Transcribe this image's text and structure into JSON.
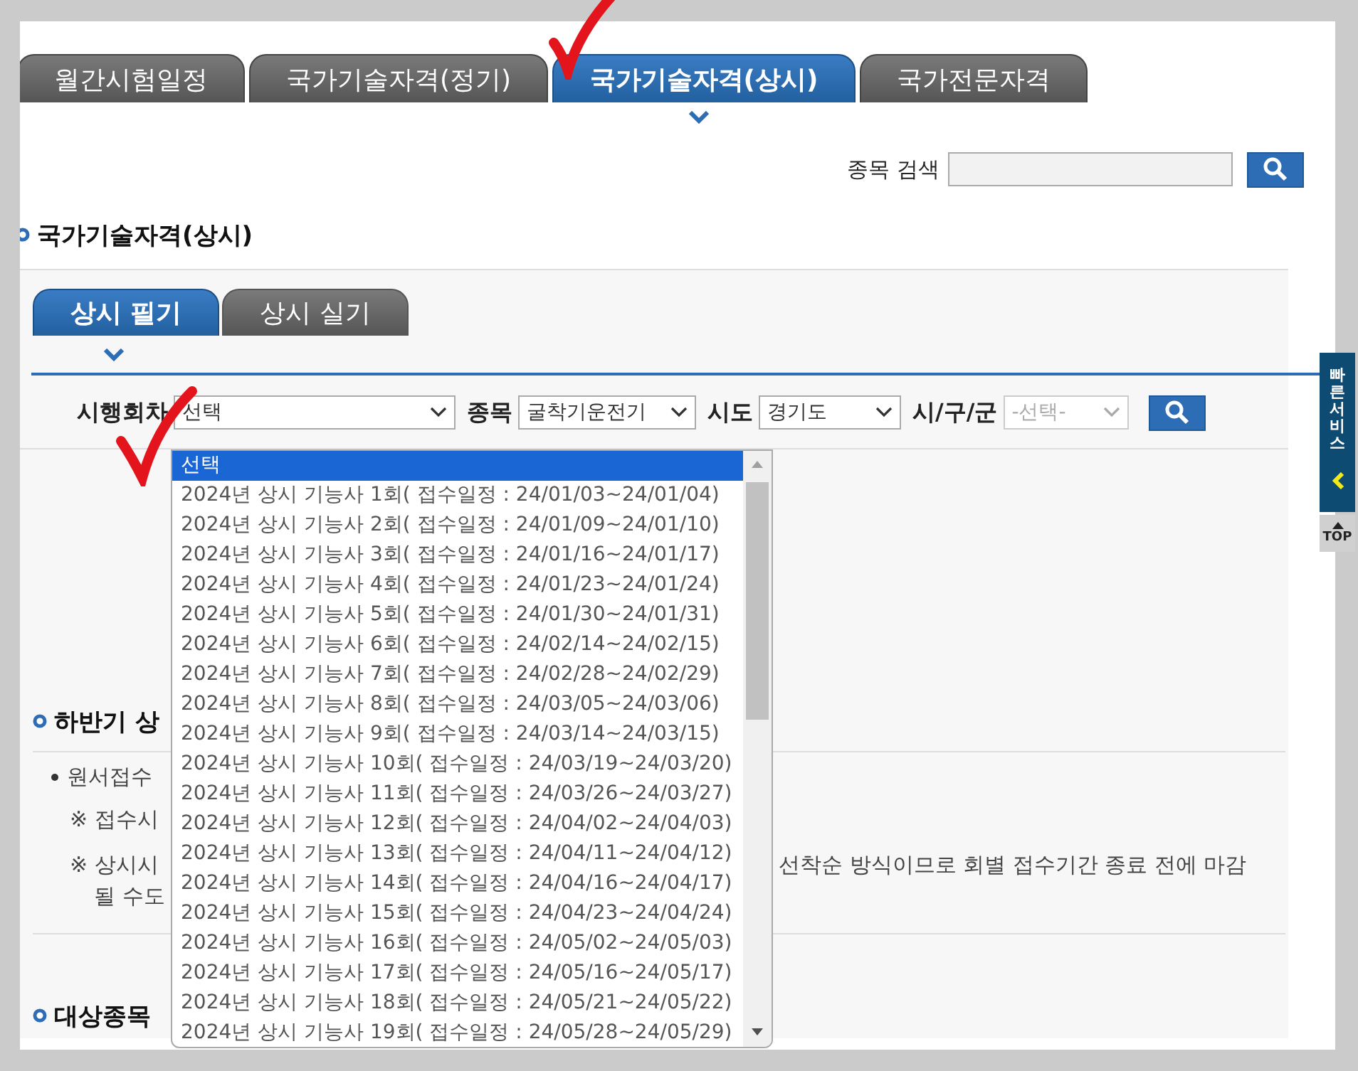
{
  "main_tabs": [
    {
      "label": "월간시험일정",
      "selected": false
    },
    {
      "label": "국가기술자격(정기)",
      "selected": false
    },
    {
      "label": "국가기술자격(상시)",
      "selected": true
    },
    {
      "label": "국가전문자격",
      "selected": false
    }
  ],
  "search": {
    "label": "종목 검색"
  },
  "section_title": "국가기술자격(상시)",
  "sub_tabs": [
    {
      "label": "상시 필기",
      "selected": true
    },
    {
      "label": "상시 실기",
      "selected": false
    }
  ],
  "filters": [
    {
      "label": "시행회차",
      "value": "선택",
      "disabled": false
    },
    {
      "label": "종목",
      "value": "굴착기운전기",
      "disabled": false
    },
    {
      "label": "시도",
      "value": "경기도",
      "disabled": false
    },
    {
      "label": "시/구/군",
      "value": "-선택-",
      "disabled": true
    }
  ],
  "dropdown": {
    "options": [
      {
        "label": "선택",
        "selected": true
      },
      {
        "label": "2024년 상시 기능사 1회( 접수일정 : 24/01/03~24/01/04)",
        "selected": false
      },
      {
        "label": "2024년 상시 기능사 2회( 접수일정 : 24/01/09~24/01/10)",
        "selected": false
      },
      {
        "label": "2024년 상시 기능사 3회( 접수일정 : 24/01/16~24/01/17)",
        "selected": false
      },
      {
        "label": "2024년 상시 기능사 4회( 접수일정 : 24/01/23~24/01/24)",
        "selected": false
      },
      {
        "label": "2024년 상시 기능사 5회( 접수일정 : 24/01/30~24/01/31)",
        "selected": false
      },
      {
        "label": "2024년 상시 기능사 6회( 접수일정 : 24/02/14~24/02/15)",
        "selected": false
      },
      {
        "label": "2024년 상시 기능사 7회( 접수일정 : 24/02/28~24/02/29)",
        "selected": false
      },
      {
        "label": "2024년 상시 기능사 8회( 접수일정 : 24/03/05~24/03/06)",
        "selected": false
      },
      {
        "label": "2024년 상시 기능사 9회( 접수일정 : 24/03/14~24/03/15)",
        "selected": false
      },
      {
        "label": "2024년 상시 기능사 10회( 접수일정 : 24/03/19~24/03/20)",
        "selected": false
      },
      {
        "label": "2024년 상시 기능사 11회( 접수일정 : 24/03/26~24/03/27)",
        "selected": false
      },
      {
        "label": "2024년 상시 기능사 12회( 접수일정 : 24/04/02~24/04/03)",
        "selected": false
      },
      {
        "label": "2024년 상시 기능사 13회( 접수일정 : 24/04/11~24/04/12)",
        "selected": false
      },
      {
        "label": "2024년 상시 기능사 14회( 접수일정 : 24/04/16~24/04/17)",
        "selected": false
      },
      {
        "label": "2024년 상시 기능사 15회( 접수일정 : 24/04/23~24/04/24)",
        "selected": false
      },
      {
        "label": "2024년 상시 기능사 16회( 접수일정 : 24/05/02~24/05/03)",
        "selected": false
      },
      {
        "label": "2024년 상시 기능사 17회( 접수일정 : 24/05/16~24/05/17)",
        "selected": false
      },
      {
        "label": "2024년 상시 기능사 18회( 접수일정 : 24/05/21~24/05/22)",
        "selected": false
      },
      {
        "label": "2024년 상시 기능사 19회( 접수일정 : 24/05/28~24/05/29)",
        "selected": false
      }
    ]
  },
  "notice": {
    "heading": "하반기 상",
    "bullet": "원서접수",
    "note_1": "※ 접수시",
    "note_2": "※ 상시시",
    "note_2_right": "선착순 방식이므로 회별 접수기간 종료 전에 마감",
    "note_2_cont": "될 수도",
    "heading_2": "대상종목"
  },
  "quick_menu": {
    "label": "빠른서비스",
    "top": "TOP"
  }
}
